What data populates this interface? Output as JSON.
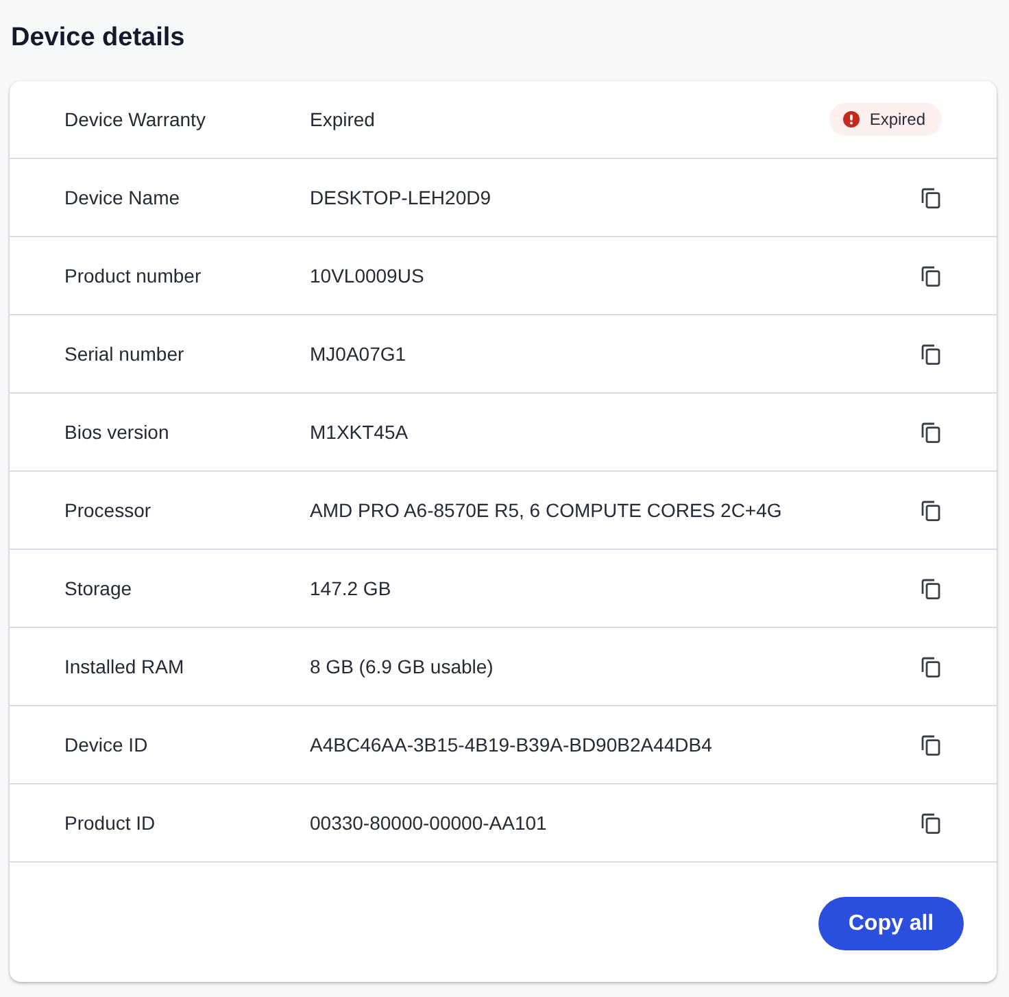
{
  "page": {
    "title": "Device details"
  },
  "rows": [
    {
      "kind": "status",
      "label": "Device Warranty",
      "value": "Expired",
      "badge": {
        "kind": "error",
        "label": "Expired"
      }
    },
    {
      "kind": "copyable",
      "label": "Device Name",
      "value": "DESKTOP-LEH20D9"
    },
    {
      "kind": "copyable",
      "label": "Product number",
      "value": "10VL0009US"
    },
    {
      "kind": "copyable",
      "label": "Serial number",
      "value": "MJ0A07G1"
    },
    {
      "kind": "copyable",
      "label": "Bios version",
      "value": "M1XKT45A"
    },
    {
      "kind": "copyable",
      "label": "Processor",
      "value": "AMD PRO A6-8570E R5, 6 COMPUTE CORES 2C+4G"
    },
    {
      "kind": "copyable",
      "label": "Storage",
      "value": "147.2 GB"
    },
    {
      "kind": "copyable",
      "label": "Installed RAM",
      "value": "8 GB (6.9 GB usable)"
    },
    {
      "kind": "copyable",
      "label": "Device ID",
      "value": "A4BC46AA-3B15-4B19-B39A-BD90B2A44DB4"
    },
    {
      "kind": "copyable",
      "label": "Product ID",
      "value": "00330-80000-00000-AA101"
    }
  ],
  "footer": {
    "button": "Copy all"
  }
}
